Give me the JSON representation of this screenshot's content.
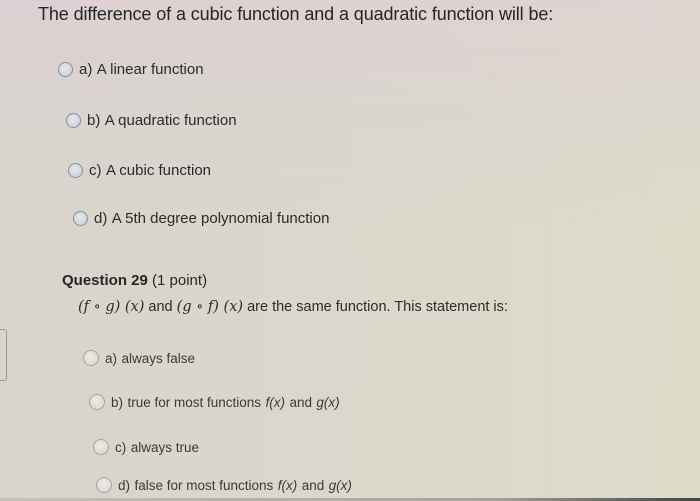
{
  "question_28": {
    "prompt": "The difference of a cubic function and a quadratic function will be:",
    "options": [
      {
        "letter": "a)",
        "text": "A linear function"
      },
      {
        "letter": "b)",
        "text": "A quadratic function"
      },
      {
        "letter": "c)",
        "text": "A cubic function"
      },
      {
        "letter": "d)",
        "text": "A 5th degree polynomial function"
      }
    ]
  },
  "question_29": {
    "number_label": "Question 29",
    "points_label": "(1 point)",
    "prompt": {
      "expr1": "(f ∘ g) (x)",
      "connector": "and",
      "expr2": "(g ∘ f) (x)",
      "rest": "are the same function.  This statement is:"
    },
    "options": [
      {
        "letter": "a)",
        "text": "always false",
        "suffix_f": "",
        "and": "",
        "suffix_g": ""
      },
      {
        "letter": "b)",
        "text": "true for most functions",
        "suffix_f": "f(x)",
        "and": "and",
        "suffix_g": "g(x)"
      },
      {
        "letter": "c)",
        "text": "always true",
        "suffix_f": "",
        "and": "",
        "suffix_g": ""
      },
      {
        "letter": "d)",
        "text": "false for most functions",
        "suffix_f": "f(x)",
        "and": "and",
        "suffix_g": "g(x)"
      }
    ]
  }
}
